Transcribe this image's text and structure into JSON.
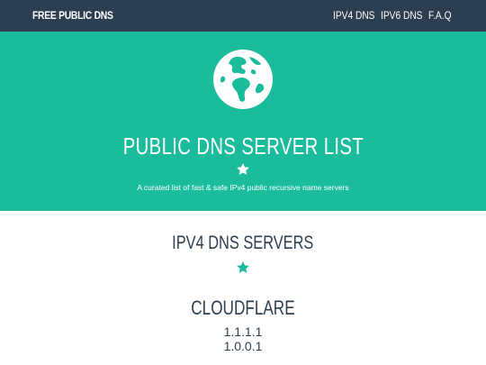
{
  "nav": {
    "brand": "FREE PUBLIC DNS",
    "links": [
      {
        "label": "IPV4 DNS"
      },
      {
        "label": "IPV6 DNS"
      },
      {
        "label": "F.A.Q"
      }
    ]
  },
  "hero": {
    "icon": "globe-icon",
    "title": "PUBLIC DNS SERVER LIST",
    "star_icon": "star-icon",
    "subtitle": "A curated list of fast & safe IPv4 public recursive name servers"
  },
  "section": {
    "title": "IPV4 DNS SERVERS",
    "star_icon": "star-icon"
  },
  "providers": [
    {
      "name": "CLOUDFLARE",
      "ips": [
        "1.1.1.1",
        "1.0.0.1"
      ]
    }
  ],
  "colors": {
    "navbar": "#2c3e50",
    "accent": "#1abc9c",
    "text_dark": "#2c3e50",
    "white": "#ffffff"
  }
}
